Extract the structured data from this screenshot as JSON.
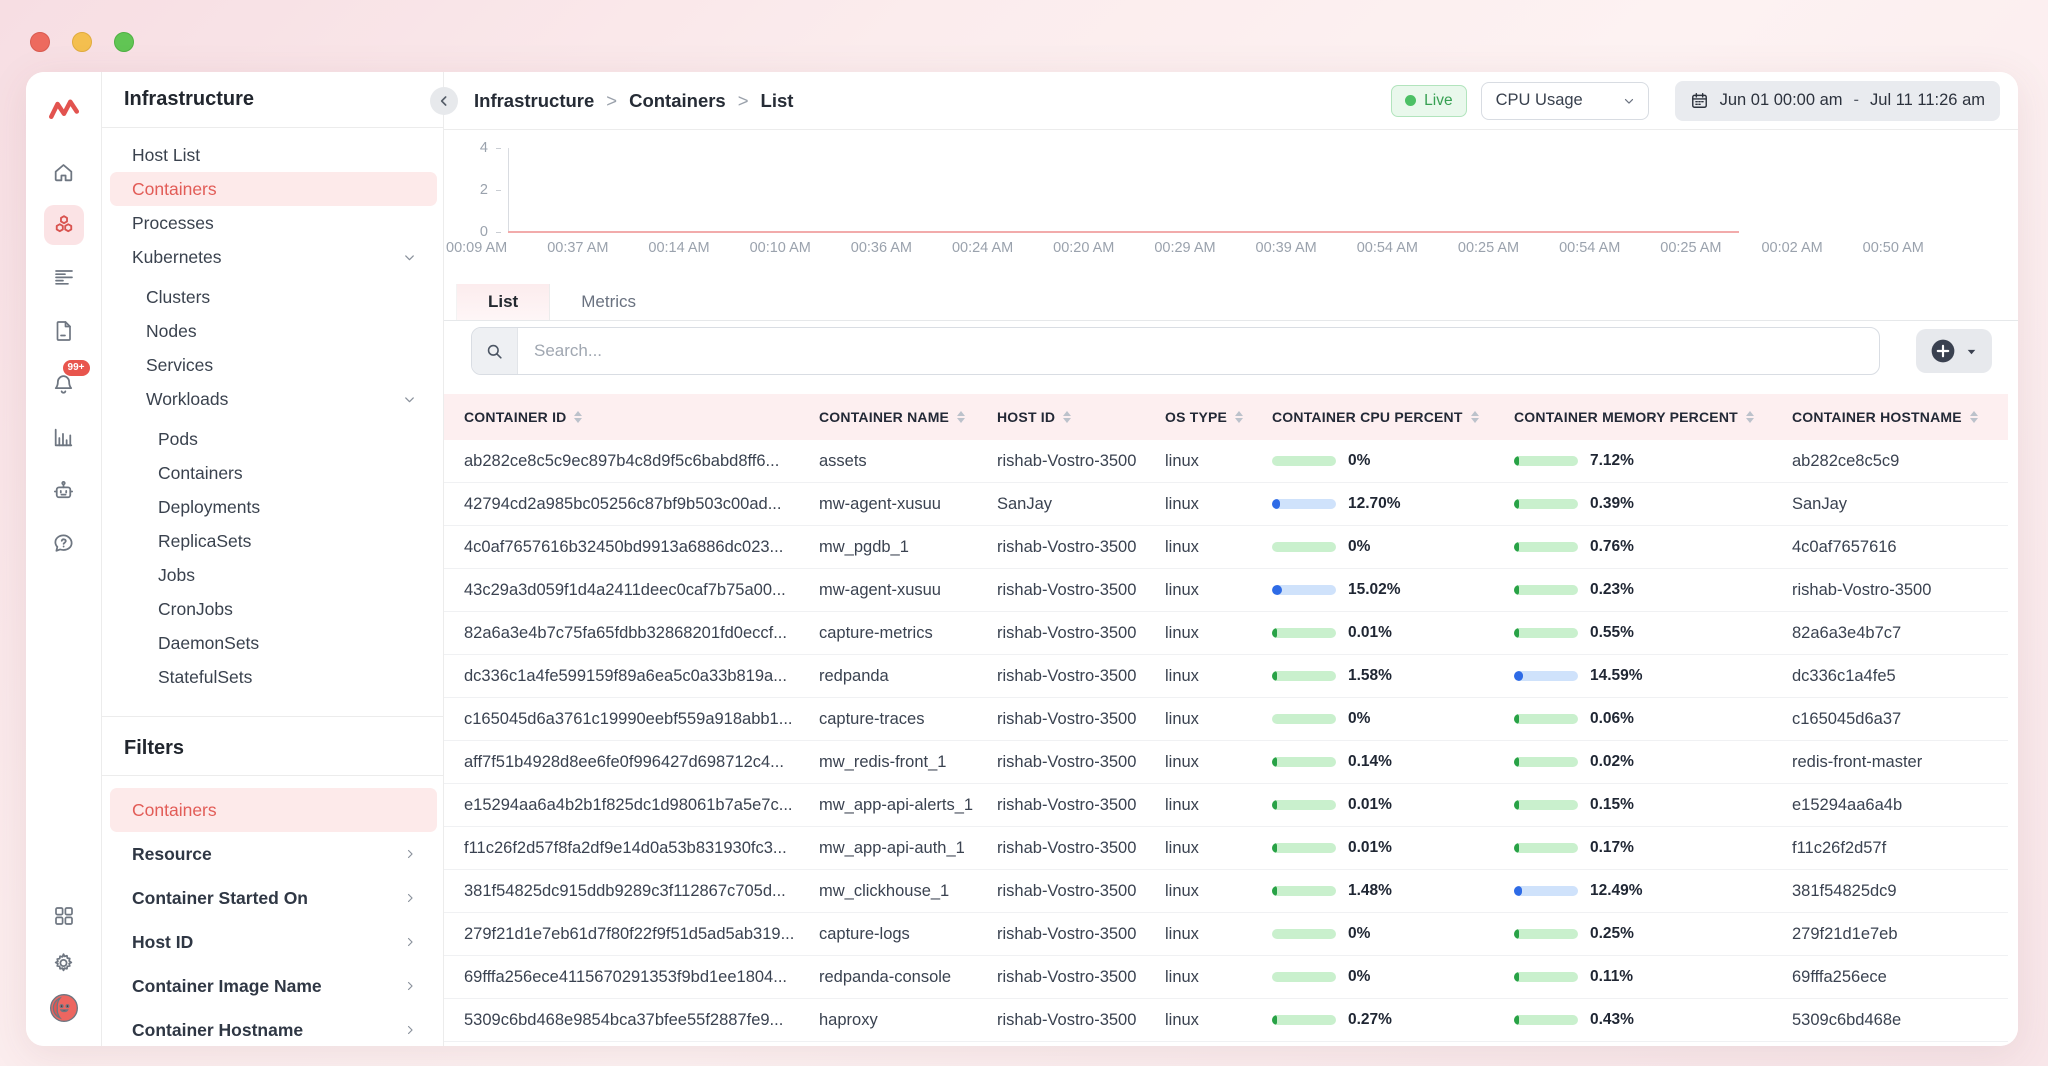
{
  "window_chrome": {
    "traffic_lights": [
      "close",
      "minimize",
      "maximize"
    ]
  },
  "icon_rail": {
    "logo": "middleware-logo",
    "top": [
      {
        "name": "home",
        "icon": "home",
        "active": false
      },
      {
        "name": "infrastructure",
        "icon": "infra",
        "active": true
      },
      {
        "name": "logs",
        "icon": "logs",
        "active": false
      },
      {
        "name": "reports",
        "icon": "doc",
        "active": false
      },
      {
        "name": "alerts",
        "icon": "bell",
        "active": false,
        "badge": "99+"
      },
      {
        "name": "dashboards",
        "icon": "chart",
        "active": false
      },
      {
        "name": "bot",
        "icon": "robot",
        "active": false
      },
      {
        "name": "help",
        "icon": "help",
        "active": false
      }
    ],
    "bottom": [
      {
        "name": "apps",
        "icon": "grid"
      },
      {
        "name": "settings",
        "icon": "gear"
      },
      {
        "name": "account",
        "icon": "avatar"
      }
    ]
  },
  "sidebar": {
    "title": "Infrastructure",
    "items": [
      {
        "label": "Host List",
        "level": 0
      },
      {
        "label": "Containers",
        "level": 0,
        "active": true
      },
      {
        "label": "Processes",
        "level": 0
      },
      {
        "label": "Kubernetes",
        "level": 0,
        "expanded": true
      },
      {
        "label": "Clusters",
        "level": 1,
        "gap": true
      },
      {
        "label": "Nodes",
        "level": 1
      },
      {
        "label": "Services",
        "level": 1
      },
      {
        "label": "Workloads",
        "level": 1,
        "expanded": true
      },
      {
        "label": "Pods",
        "level": 2,
        "gap": true
      },
      {
        "label": "Containers",
        "level": 2
      },
      {
        "label": "Deployments",
        "level": 2
      },
      {
        "label": "ReplicaSets",
        "level": 2
      },
      {
        "label": "Jobs",
        "level": 2
      },
      {
        "label": "CronJobs",
        "level": 2
      },
      {
        "label": "DaemonSets",
        "level": 2
      },
      {
        "label": "StatefulSets",
        "level": 2
      }
    ],
    "filters_title": "Filters",
    "filters": [
      {
        "label": "Containers",
        "active": true
      },
      {
        "label": "Resource",
        "chevron": true
      },
      {
        "label": "Container Started On",
        "chevron": true
      },
      {
        "label": "Host ID",
        "chevron": true
      },
      {
        "label": "Container Image Name",
        "chevron": true
      },
      {
        "label": "Container Hostname",
        "chevron": true
      }
    ]
  },
  "header": {
    "breadcrumb": [
      "Infrastructure",
      "Containers",
      "List"
    ],
    "live_label": "Live",
    "metric_select": "CPU Usage",
    "date_start": "Jun 01 00:00 am",
    "date_sep": "-",
    "date_end": "Jul 11 11:26 am"
  },
  "chart_data": {
    "type": "line",
    "title": "",
    "xlabel": "",
    "ylabel": "",
    "ylim": [
      0,
      4
    ],
    "yticks": [
      4,
      2,
      0
    ],
    "grid": false,
    "line_color": "#f2abab",
    "x": [
      "00:09 AM",
      "00:37 AM",
      "00:14 AM",
      "00:10 AM",
      "00:36 AM",
      "00:24 AM",
      "00:20 AM",
      "00:29 AM",
      "00:39 AM",
      "00:54 AM",
      "00:25 AM",
      "00:54 AM",
      "00:25 AM",
      "00:02 AM",
      "00:50 AM"
    ],
    "values": [
      0,
      0,
      0,
      0,
      0,
      0,
      0,
      0,
      0,
      0,
      0,
      0,
      0,
      0,
      0
    ]
  },
  "tabs": [
    {
      "label": "List",
      "active": true
    },
    {
      "label": "Metrics",
      "active": false
    }
  ],
  "search": {
    "placeholder": "Search..."
  },
  "table": {
    "columns": [
      "CONTAINER ID",
      "CONTAINER NAME",
      "HOST ID",
      "OS TYPE",
      "CONTAINER CPU PERCENT",
      "CONTAINER MEMORY PERCENT",
      "CONTAINER HOSTNAME"
    ],
    "rows": [
      {
        "container_id": "ab282ce8c5c9ec897b4c8d9f5c6babd8ff6...",
        "container_name": "assets",
        "host_id": "rishab-Vostro-3500",
        "os_type": "linux",
        "cpu": {
          "label": "0%",
          "value": 0,
          "color": "green"
        },
        "memory": {
          "label": "7.12%",
          "value": 7.12,
          "color": "green"
        },
        "hostname": "ab282ce8c5c9"
      },
      {
        "container_id": "42794cd2a985bc05256c87bf9b503c00ad...",
        "container_name": "mw-agent-xusuu",
        "host_id": "SanJay",
        "os_type": "linux",
        "cpu": {
          "label": "12.70%",
          "value": 12.7,
          "color": "blue"
        },
        "memory": {
          "label": "0.39%",
          "value": 0.39,
          "color": "green"
        },
        "hostname": "SanJay"
      },
      {
        "container_id": "4c0af7657616b32450bd9913a6886dc023...",
        "container_name": "mw_pgdb_1",
        "host_id": "rishab-Vostro-3500",
        "os_type": "linux",
        "cpu": {
          "label": "0%",
          "value": 0,
          "color": "green"
        },
        "memory": {
          "label": "0.76%",
          "value": 0.76,
          "color": "green"
        },
        "hostname": "4c0af7657616"
      },
      {
        "container_id": "43c29a3d059f1d4a2411deec0caf7b75a00...",
        "container_name": "mw-agent-xusuu",
        "host_id": "rishab-Vostro-3500",
        "os_type": "linux",
        "cpu": {
          "label": "15.02%",
          "value": 15.02,
          "color": "blue"
        },
        "memory": {
          "label": "0.23%",
          "value": 0.23,
          "color": "green"
        },
        "hostname": "rishab-Vostro-3500"
      },
      {
        "container_id": "82a6a3e4b7c75fa65fdbb32868201fd0eccf...",
        "container_name": "capture-metrics",
        "host_id": "rishab-Vostro-3500",
        "os_type": "linux",
        "cpu": {
          "label": "0.01%",
          "value": 0.01,
          "color": "green"
        },
        "memory": {
          "label": "0.55%",
          "value": 0.55,
          "color": "green"
        },
        "hostname": "82a6a3e4b7c7"
      },
      {
        "container_id": "dc336c1a4fe599159f89a6ea5c0a33b819a...",
        "container_name": "redpanda",
        "host_id": "rishab-Vostro-3500",
        "os_type": "linux",
        "cpu": {
          "label": "1.58%",
          "value": 1.58,
          "color": "green"
        },
        "memory": {
          "label": "14.59%",
          "value": 14.59,
          "color": "blue"
        },
        "hostname": "dc336c1a4fe5"
      },
      {
        "container_id": "c165045d6a3761c19990eebf559a918abb1...",
        "container_name": "capture-traces",
        "host_id": "rishab-Vostro-3500",
        "os_type": "linux",
        "cpu": {
          "label": "0%",
          "value": 0,
          "color": "green"
        },
        "memory": {
          "label": "0.06%",
          "value": 0.06,
          "color": "green"
        },
        "hostname": "c165045d6a37"
      },
      {
        "container_id": "aff7f51b4928d8ee6fe0f996427d698712c4...",
        "container_name": "mw_redis-front_1",
        "host_id": "rishab-Vostro-3500",
        "os_type": "linux",
        "cpu": {
          "label": "0.14%",
          "value": 0.14,
          "color": "green"
        },
        "memory": {
          "label": "0.02%",
          "value": 0.02,
          "color": "green"
        },
        "hostname": "redis-front-master"
      },
      {
        "container_id": "e15294aa6a4b2b1f825dc1d98061b7a5e7c...",
        "container_name": "mw_app-api-alerts_1",
        "host_id": "rishab-Vostro-3500",
        "os_type": "linux",
        "cpu": {
          "label": "0.01%",
          "value": 0.01,
          "color": "green"
        },
        "memory": {
          "label": "0.15%",
          "value": 0.15,
          "color": "green"
        },
        "hostname": "e15294aa6a4b"
      },
      {
        "container_id": "f11c26f2d57f8fa2df9e14d0a53b831930fc3...",
        "container_name": "mw_app-api-auth_1",
        "host_id": "rishab-Vostro-3500",
        "os_type": "linux",
        "cpu": {
          "label": "0.01%",
          "value": 0.01,
          "color": "green"
        },
        "memory": {
          "label": "0.17%",
          "value": 0.17,
          "color": "green"
        },
        "hostname": "f11c26f2d57f"
      },
      {
        "container_id": "381f54825dc915ddb9289c3f112867c705d...",
        "container_name": "mw_clickhouse_1",
        "host_id": "rishab-Vostro-3500",
        "os_type": "linux",
        "cpu": {
          "label": "1.48%",
          "value": 1.48,
          "color": "green"
        },
        "memory": {
          "label": "12.49%",
          "value": 12.49,
          "color": "blue"
        },
        "hostname": "381f54825dc9"
      },
      {
        "container_id": "279f21d1e7eb61d7f80f22f9f51d5ad5ab319...",
        "container_name": "capture-logs",
        "host_id": "rishab-Vostro-3500",
        "os_type": "linux",
        "cpu": {
          "label": "0%",
          "value": 0,
          "color": "green"
        },
        "memory": {
          "label": "0.25%",
          "value": 0.25,
          "color": "green"
        },
        "hostname": "279f21d1e7eb"
      },
      {
        "container_id": "69fffa256ece4115670291353f9bd1ee1804...",
        "container_name": "redpanda-console",
        "host_id": "rishab-Vostro-3500",
        "os_type": "linux",
        "cpu": {
          "label": "0%",
          "value": 0,
          "color": "green"
        },
        "memory": {
          "label": "0.11%",
          "value": 0.11,
          "color": "green"
        },
        "hostname": "69fffa256ece"
      },
      {
        "container_id": "5309c6bd468e9854bca37bfee55f2887fe9...",
        "container_name": "haproxy",
        "host_id": "rishab-Vostro-3500",
        "os_type": "linux",
        "cpu": {
          "label": "0.27%",
          "value": 0.27,
          "color": "green"
        },
        "memory": {
          "label": "0.43%",
          "value": 0.43,
          "color": "green"
        },
        "hostname": "5309c6bd468e"
      }
    ]
  },
  "colors": {
    "accent_red": "#e25c57",
    "active_pink_bg": "#fdeaea",
    "table_header_bg": "#fdeff0",
    "green_fill": "#28a246",
    "green_track": "#c9f0cd",
    "blue_fill": "#2e6be6",
    "blue_track": "#cfe2fb",
    "live_green": "#36a052",
    "chart_line": "#f2abab"
  }
}
